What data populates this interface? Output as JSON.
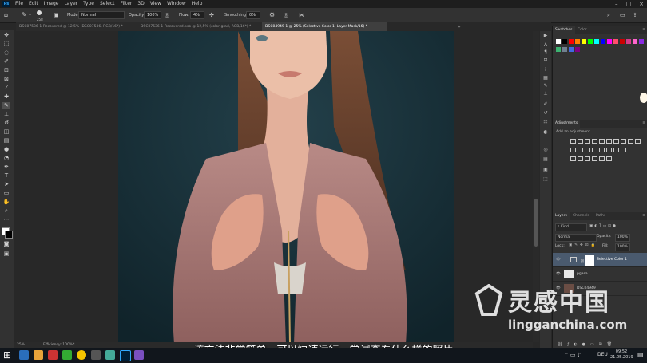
{
  "app": {
    "logo": "Ps",
    "menus": [
      "File",
      "Edit",
      "Image",
      "Layer",
      "Type",
      "Select",
      "Filter",
      "3D",
      "View",
      "Window",
      "Help"
    ],
    "window_controls": [
      "–",
      "□",
      "×"
    ]
  },
  "options_bar": {
    "brush_size": "258",
    "mode_label": "Mode:",
    "mode_value": "Normal",
    "opacity_label": "Opacity:",
    "opacity_value": "100%",
    "flow_label": "Flow:",
    "flow_value": "4%",
    "smoothing_label": "Smoothing:",
    "smoothing_value": "0%"
  },
  "tabs": [
    {
      "label": "DSC07536-1-Recovered @ 12,5% (DSC07536, RGB/16*) *"
    },
    {
      "label": "DSC07536-1-Recovered.psb @ 12,5% (color grad, RGB/16*) *"
    },
    {
      "label": "DSC04949-1 @ 25% (Selective Color 1, Layer Mask/16) *"
    }
  ],
  "status": {
    "zoom": "25%",
    "efficiency": "Efficiency: 100%*"
  },
  "panels": {
    "swatches_tabs": [
      "Swatches",
      "Color"
    ],
    "adjustments_title": "Adjustments",
    "adjustments_subtitle": "Add an adjustment",
    "layers_tabs": [
      "Layers",
      "Channels",
      "Paths"
    ],
    "kind_label": "Kind",
    "blend_mode": "Normal",
    "opacity_label": "Opacity:",
    "opacity_value": "100%",
    "lock_label": "Lock:",
    "fill_label": "Fill:",
    "fill_value": "100%",
    "layers": [
      {
        "name": "Selective Color 1"
      },
      {
        "name": "pgasa"
      },
      {
        "name": "DSC04949"
      }
    ]
  },
  "subtitle": "该方法非常简单，可以快速运行，尝试查看什么样的照片",
  "watermark": {
    "brand": "灵感中国",
    "url": "lingganchina.com"
  },
  "taskbar": {
    "lang": "DEU",
    "time": "09:52",
    "date": "21.05.2019"
  },
  "colors": {
    "swatches_row1": [
      "#ffffff",
      "#000000",
      "#ff0000",
      "#ff8000",
      "#ffff00",
      "#00ff00",
      "#00ffff",
      "#0000ff",
      "#ff00ff",
      "#ff4d6d",
      "#cc0000",
      "#d63a8a",
      "#ff66cc",
      "#8a2be2"
    ],
    "swatches_row2": [
      "#3cb371",
      "#708090",
      "#4169e1",
      "#800080"
    ]
  }
}
